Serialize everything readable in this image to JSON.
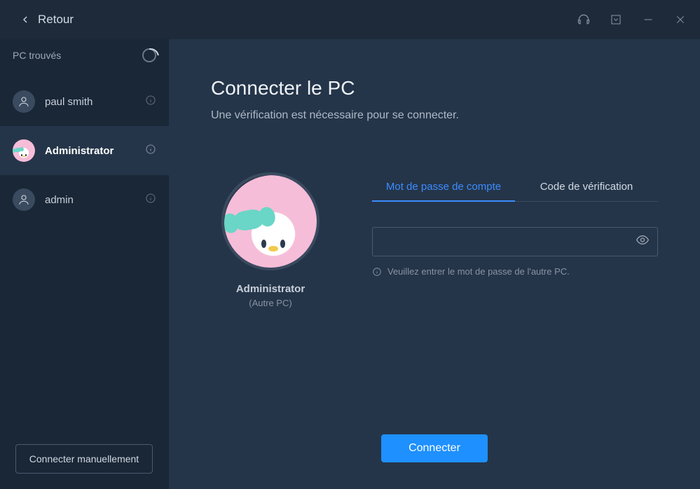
{
  "titlebar": {
    "back_label": "Retour"
  },
  "sidebar": {
    "header": "PC trouvés",
    "items": [
      {
        "name": "paul smith"
      },
      {
        "name": "Administrator"
      },
      {
        "name": "admin"
      }
    ],
    "manual_button": "Connecter manuellement"
  },
  "main": {
    "title": "Connecter le PC",
    "subtitle": "Une vérification est nécessaire pour se connecter.",
    "user": {
      "name": "Administrator",
      "sub": "(Autre PC)"
    },
    "tabs": {
      "password": "Mot de passe de compte",
      "code": "Code de vérification"
    },
    "password_value": "",
    "hint": "Veuillez entrer le mot de passe de l'autre PC.",
    "connect_button": "Connecter"
  }
}
